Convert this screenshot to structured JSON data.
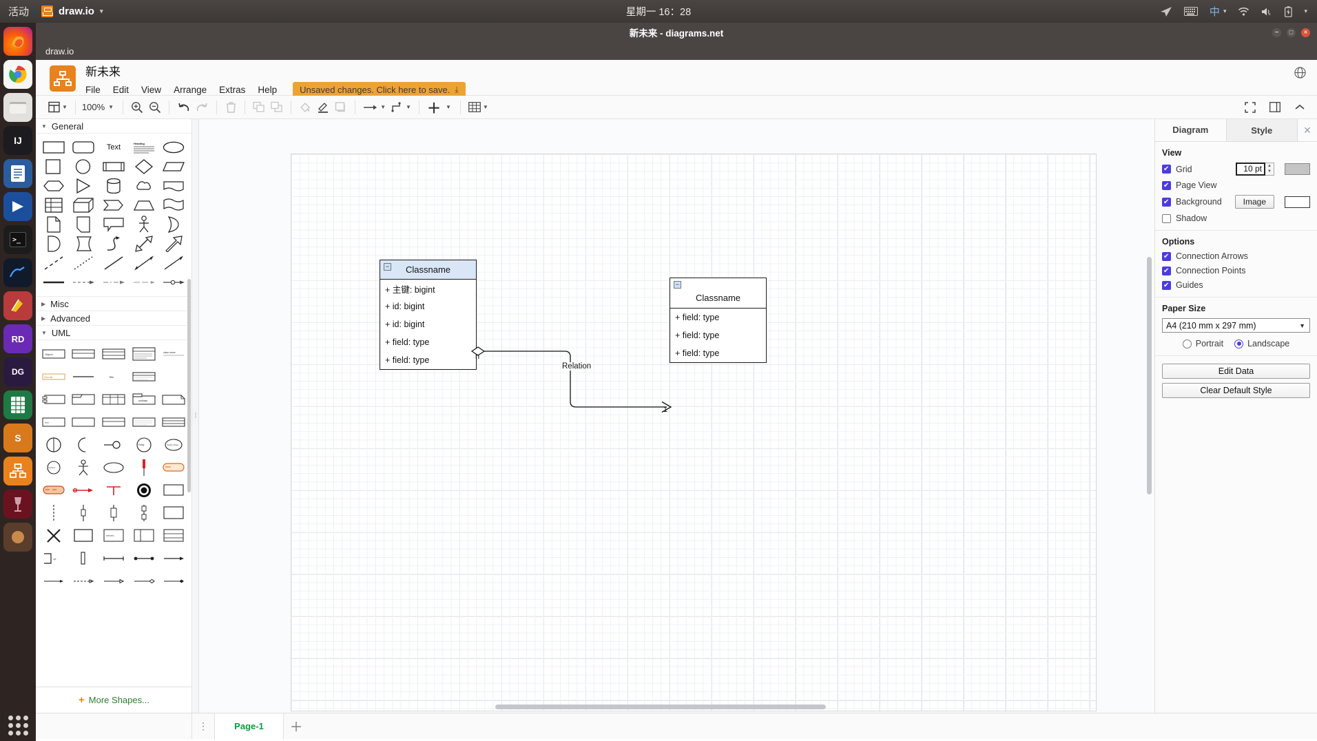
{
  "system_bar": {
    "activities": "活动",
    "app_name": "draw.io",
    "clock": "星期一 16：28",
    "tray": [
      "send-icon",
      "keyboard-icon",
      "input-method",
      "wifi-icon",
      "volume-muted-icon",
      "battery-charging-icon"
    ],
    "input_method": "中"
  },
  "window": {
    "title": "新未来 - diagrams.net",
    "tab_label": "draw.io"
  },
  "header": {
    "filename": "新未来",
    "menus": [
      "File",
      "Edit",
      "View",
      "Arrange",
      "Extras",
      "Help"
    ],
    "unsaved_label": "Unsaved changes. Click here to save.",
    "globe_icon": "globe-icon"
  },
  "toolbar": {
    "view_label": "view-dropdown",
    "zoom": "100%",
    "items": [
      "view-icon",
      "zoom-in-icon",
      "zoom-out-icon",
      "undo-icon",
      "redo-icon",
      "delete-icon",
      "to-front-icon",
      "to-back-icon",
      "fill-color-icon",
      "line-color-icon",
      "shadow-icon",
      "connection-icon",
      "waypoints-icon",
      "insert-icon",
      "table-icon"
    ],
    "right_items": [
      "fullscreen-icon",
      "format-panel-icon",
      "collapse-icon"
    ]
  },
  "shapes_panel": {
    "sections": [
      {
        "title": "General",
        "expanded": true
      },
      {
        "title": "Misc",
        "expanded": false
      },
      {
        "title": "Advanced",
        "expanded": false
      },
      {
        "title": "UML",
        "expanded": true
      }
    ],
    "general_text_shape": "Text",
    "more_shapes": "More Shapes..."
  },
  "canvas": {
    "classes": [
      {
        "name": "Classname",
        "selected": true,
        "attributes": [
          "+ 主键: bigint",
          "+ id: bigint",
          "+ id: bigint",
          "+ field: type",
          "+ field: type"
        ]
      },
      {
        "name": "Classname",
        "selected": false,
        "attributes": [
          "+ field: type",
          "+ field: type",
          "+ field: type"
        ]
      }
    ],
    "edge": {
      "label": "Relation",
      "source_multiplicity": "n",
      "target_multiplicity": "1"
    }
  },
  "format_panel": {
    "tabs": [
      {
        "label": "Diagram",
        "active": true
      },
      {
        "label": "Style",
        "active": false
      }
    ],
    "close_icon": "close-icon",
    "view": {
      "heading": "View",
      "grid": {
        "label": "Grid",
        "checked": true,
        "size": "10 pt",
        "color": "#c4c4c4"
      },
      "page_view": {
        "label": "Page View",
        "checked": true
      },
      "background": {
        "label": "Background",
        "checked": true,
        "image_button": "Image",
        "color": "#ffffff"
      },
      "shadow": {
        "label": "Shadow",
        "checked": false
      }
    },
    "options": {
      "heading": "Options",
      "items": [
        {
          "label": "Connection Arrows",
          "checked": true
        },
        {
          "label": "Connection Points",
          "checked": true
        },
        {
          "label": "Guides",
          "checked": true
        }
      ]
    },
    "paper": {
      "heading": "Paper Size",
      "selected": "A4 (210 mm x 297 mm)",
      "portrait": {
        "label": "Portrait",
        "selected": false
      },
      "landscape": {
        "label": "Landscape",
        "selected": true
      }
    },
    "actions": [
      "Edit Data",
      "Clear Default Style"
    ]
  },
  "footer": {
    "page_menu_icon": "page-menu-icon",
    "pages": [
      "Page-1"
    ],
    "add_page_icon": "plus-icon"
  }
}
